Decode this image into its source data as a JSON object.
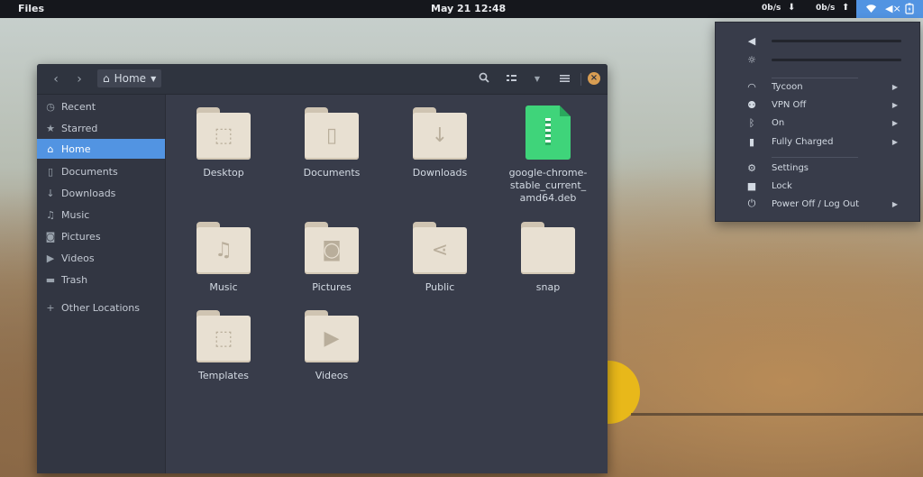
{
  "topbar": {
    "app_name": "Files",
    "clock": "May 21  12:48",
    "net_down": "0b/s",
    "net_down_arrow": "⬇",
    "net_up": "0b/s",
    "net_up_arrow": "⬆",
    "icons": [
      "wifi-icon",
      "volume-icon",
      "battery-icon"
    ]
  },
  "window": {
    "location": "Home",
    "header_icons": [
      "back-icon",
      "forward-icon",
      "search-icon",
      "view-toggle-icon",
      "chevron-down-icon",
      "hamburger-menu-icon",
      "close-icon"
    ]
  },
  "sidebar": {
    "items": [
      {
        "label": "Recent",
        "icon": "clock-icon"
      },
      {
        "label": "Starred",
        "icon": "star-icon"
      },
      {
        "label": "Home",
        "icon": "home-icon",
        "active": true
      },
      {
        "label": "Documents",
        "icon": "document-icon"
      },
      {
        "label": "Downloads",
        "icon": "download-icon"
      },
      {
        "label": "Music",
        "icon": "music-icon"
      },
      {
        "label": "Pictures",
        "icon": "camera-icon"
      },
      {
        "label": "Videos",
        "icon": "video-icon"
      },
      {
        "label": "Trash",
        "icon": "trash-icon"
      },
      {
        "label": "Other Locations",
        "icon": "plus-icon"
      }
    ]
  },
  "files": [
    {
      "name": "Desktop",
      "type": "folder",
      "icon": "desktop-folder-icon"
    },
    {
      "name": "Documents",
      "type": "folder",
      "icon": "document-folder-icon"
    },
    {
      "name": "Downloads",
      "type": "folder",
      "icon": "download-folder-icon"
    },
    {
      "name_lines": [
        "google-chrome-",
        "stable_current_",
        "amd64.deb"
      ],
      "type": "archive",
      "icon": "archive-file-icon"
    },
    {
      "name": "Music",
      "type": "folder",
      "icon": "music-folder-icon"
    },
    {
      "name": "Pictures",
      "type": "folder",
      "icon": "pictures-folder-icon"
    },
    {
      "name": "Public",
      "type": "folder",
      "icon": "share-folder-icon"
    },
    {
      "name": "snap",
      "type": "folder",
      "icon": "plain-folder-icon"
    },
    {
      "name": "Templates",
      "type": "folder",
      "icon": "template-folder-icon"
    },
    {
      "name": "Videos",
      "type": "folder",
      "icon": "video-folder-icon"
    }
  ],
  "system_menu": {
    "wifi": "Tycoon",
    "vpn": "VPN Off",
    "bluetooth": "On",
    "battery": "Fully Charged",
    "settings": "Settings",
    "lock": "Lock",
    "power": "Power Off / Log Out"
  },
  "colors": {
    "accent": "#5294e2",
    "window_bg": "#383c4a",
    "header_bg": "#2f343f",
    "archive_green": "#3fd47a"
  }
}
